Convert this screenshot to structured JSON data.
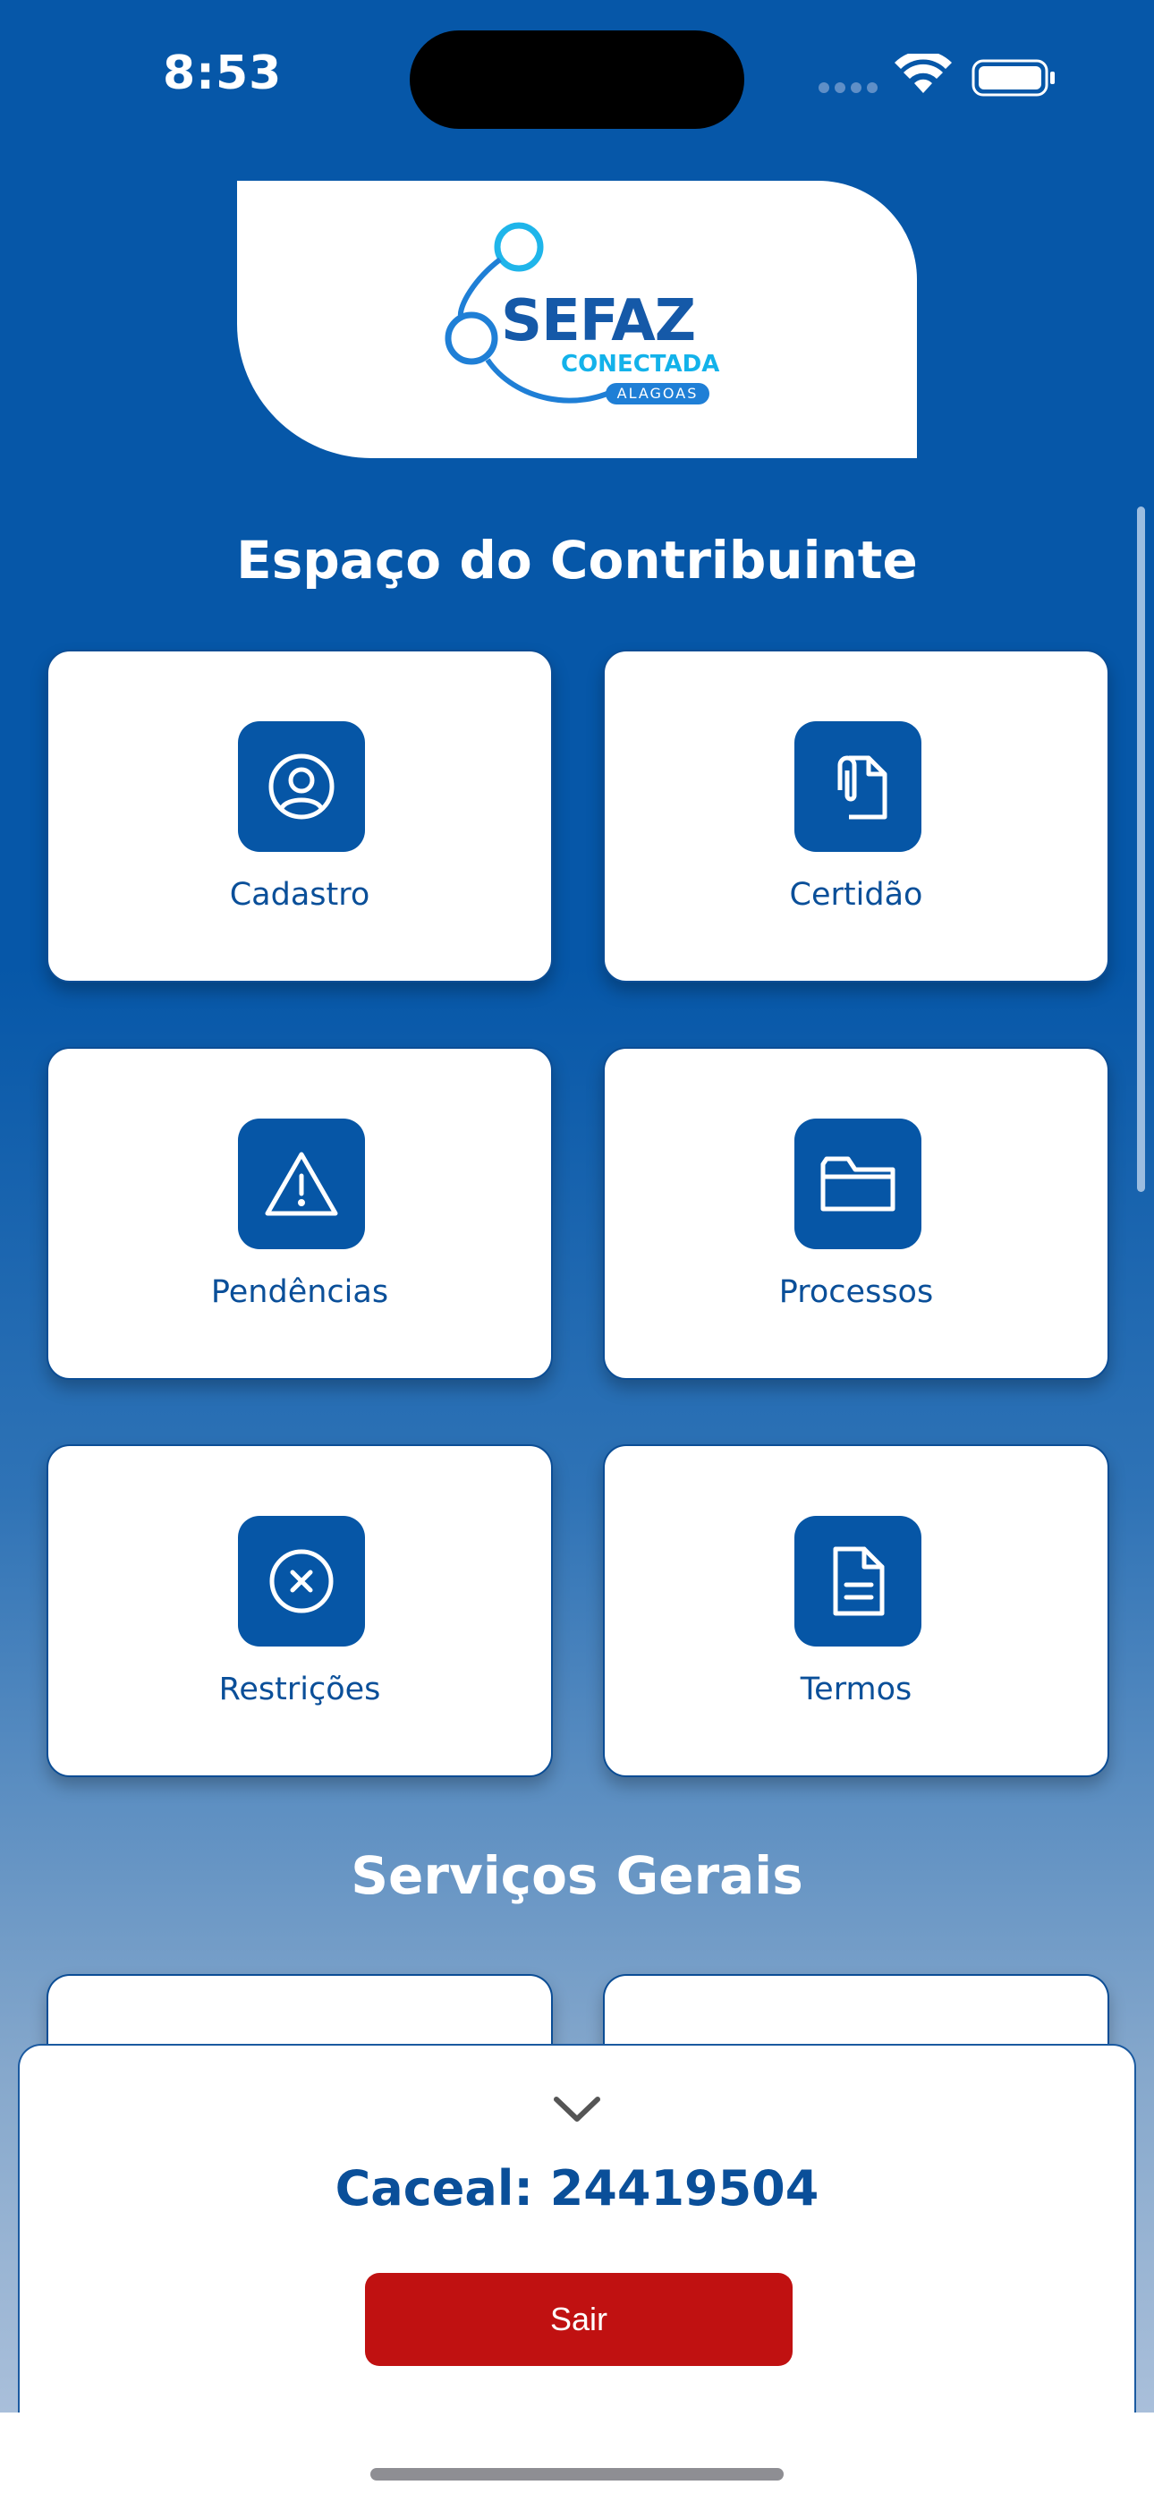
{
  "status_bar": {
    "time": "8:53"
  },
  "logo": {
    "title": "SEFAZ",
    "subtitle": "CONECTADA",
    "state": "ALAGOAS"
  },
  "contribuinte": {
    "title": "Espaço do Contribuinte",
    "tiles": [
      {
        "label": "Cadastro",
        "icon": "user-circle-icon"
      },
      {
        "label": "Certidão",
        "icon": "paperclip-document-icon"
      },
      {
        "label": "Pendências",
        "icon": "warning-triangle-icon"
      },
      {
        "label": "Processos",
        "icon": "folder-icon"
      },
      {
        "label": "Restrições",
        "icon": "x-circle-icon"
      },
      {
        "label": "Termos",
        "icon": "document-text-icon"
      }
    ]
  },
  "servicos": {
    "title": "Serviços Gerais"
  },
  "bottom_sheet": {
    "caceal": "Caceal: 24419504",
    "logout_label": "Sair"
  },
  "colors": {
    "primary": "#0656a6",
    "logout": "#c01111",
    "text_blue": "#0a4f99"
  }
}
